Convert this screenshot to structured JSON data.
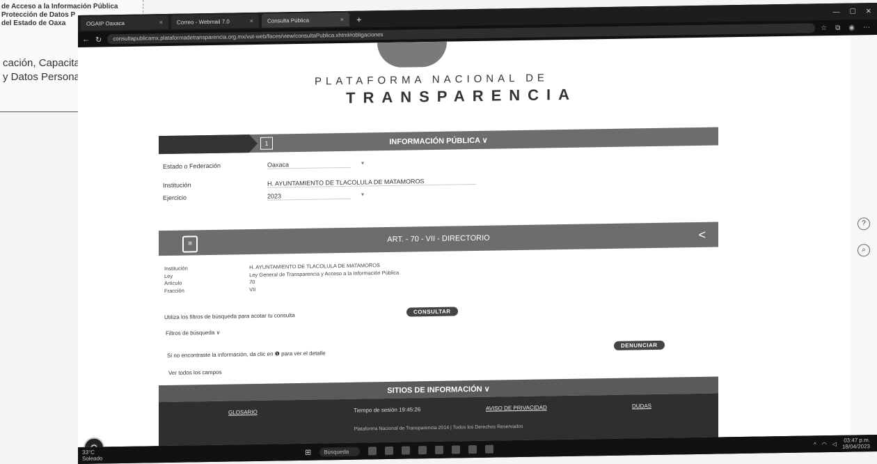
{
  "paper": {
    "line1": "de Acceso a la Información Pública",
    "line2": "Protección de Datos P",
    "line3": "del Estado de Oaxa",
    "big1": "cación, Capacitación,",
    "big2": "y Datos Personales"
  },
  "browser": {
    "tabs": [
      {
        "label": "OGAIP Oaxaca"
      },
      {
        "label": "Correo - Webmail 7.0"
      },
      {
        "label": "Consulta Pública"
      }
    ],
    "new_tab": "+",
    "url": "consultapublicamx.plataformadetransparencia.org.mx/vut-web/faces/view/consultaPublica.xhtml#obligaciones"
  },
  "page": {
    "title_line1": "PLATAFORMA NACIONAL DE",
    "title_line2": "TRANSPARENCIA",
    "info_bar": "INFORMACIÓN PÚBLICA ∨",
    "fields": [
      {
        "label": "Estado o Federación",
        "value": "Oaxaca"
      },
      {
        "label": "Institución",
        "value": "H. AYUNTAMIENTO DE TLACOLULA DE MATAMOROS"
      },
      {
        "label": "Ejercicio",
        "value": "2023"
      }
    ],
    "section_bar": "ART. - 70 - VII - DIRECTORIO",
    "details": [
      {
        "k": "Institución",
        "v": "H. AYUNTAMIENTO DE TLACOLULA DE MATAMOROS"
      },
      {
        "k": "Ley",
        "v": "Ley General de Transparencia y Acceso a la Información Pública"
      },
      {
        "k": "Artículo",
        "v": "70"
      },
      {
        "k": "Fracción",
        "v": "VII"
      }
    ],
    "consultar_prompt": "Utiliza los filtros de búsqueda para acotar tu consulta",
    "consultar_btn": "CONSULTAR",
    "filtros_link": "Filtros de búsqueda ∨",
    "denuncia_prompt": "Si no encontraste la información, da clic en ❶ para ver el detalle",
    "denunciar_btn": "DENUNCIAR",
    "ver_campos": "Ver todos los campos",
    "sitios_bar": "SITIOS DE INFORMACIÓN ∨",
    "footer_links": [
      {
        "label": "GLOSARIO"
      },
      {
        "label": "Tiempo de sesión 19:45:26"
      },
      {
        "label": "AVISO DE PRIVACIDAD"
      },
      {
        "label": "DUDAS"
      }
    ],
    "footer_copy": "Plataforma Nacional de Transparencia 2014 | Todos los Derechos Reservados"
  },
  "taskbar": {
    "weather_temp": "33°C",
    "weather_desc": "Soleado",
    "search": "Búsqueda",
    "time": "03:47 p.m.",
    "date": "18/04/2023"
  }
}
